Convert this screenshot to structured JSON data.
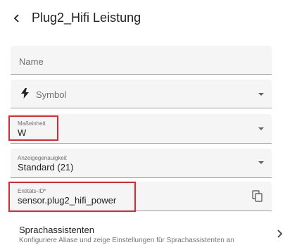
{
  "header": {
    "title": "Plug2_Hifi Leistung",
    "back_icon": "chevron-left-icon"
  },
  "form": {
    "name": {
      "label": "Name",
      "value": ""
    },
    "symbol": {
      "label": "Symbol",
      "icon": "lightning-bolt-icon"
    },
    "unit": {
      "label": "Maßeinheit",
      "value": "W"
    },
    "precision": {
      "label": "Anzeigegenauigkeit",
      "value": "Standard (21)"
    },
    "entity_id": {
      "label": "Entitäts-ID*",
      "value": "sensor.plug2_hifi_power",
      "copy_icon": "copy-icon"
    }
  },
  "voice_assistants": {
    "title": "Sprachassistenten",
    "subtitle": "Konfiguriere Aliase und zeige Einstellungen für Sprachassistenten an"
  },
  "colors": {
    "field_bg": "#f5f5f5",
    "highlight": "#e8232a",
    "text": "#212121",
    "muted": "#6f6f6f"
  }
}
